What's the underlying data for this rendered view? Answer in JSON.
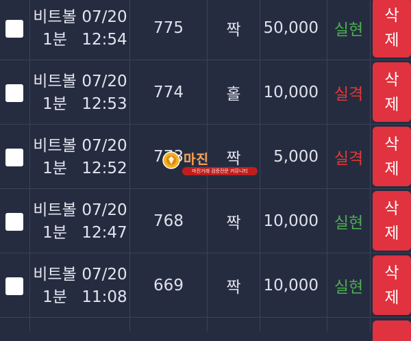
{
  "rows": [
    {
      "game_line1": "비트볼",
      "game_line2": "1분",
      "date": "07/20",
      "time": "12:54",
      "round": "775",
      "pick": "짝",
      "amount": "50,000",
      "result": "실현",
      "result_type": "win",
      "delete_line1": "삭",
      "delete_line2": "제"
    },
    {
      "game_line1": "비트볼",
      "game_line2": "1분",
      "date": "07/20",
      "time": "12:53",
      "round": "774",
      "pick": "홀",
      "amount": "10,000",
      "result": "실격",
      "result_type": "lose",
      "delete_line1": "삭",
      "delete_line2": "제"
    },
    {
      "game_line1": "비트볼",
      "game_line2": "1분",
      "date": "07/20",
      "time": "12:52",
      "round": "773",
      "pick": "짝",
      "amount": "5,000",
      "result": "실격",
      "result_type": "lose",
      "delete_line1": "삭",
      "delete_line2": "제"
    },
    {
      "game_line1": "비트볼",
      "game_line2": "1분",
      "date": "07/20",
      "time": "12:47",
      "round": "768",
      "pick": "짝",
      "amount": "10,000",
      "result": "실현",
      "result_type": "win",
      "delete_line1": "삭",
      "delete_line2": "제"
    },
    {
      "game_line1": "비트볼",
      "game_line2": "1분",
      "date": "07/20",
      "time": "11:08",
      "round": "669",
      "pick": "짝",
      "amount": "10,000",
      "result": "실현",
      "result_type": "win",
      "delete_line1": "삭",
      "delete_line2": "제"
    }
  ],
  "watermark": {
    "title": "마진",
    "subtitle": "마진거래 검증전문 커뮤니티"
  },
  "colors": {
    "background": "#262c40",
    "win": "#4caf50",
    "lose": "#e53935",
    "delete_button": "#e0323f"
  }
}
